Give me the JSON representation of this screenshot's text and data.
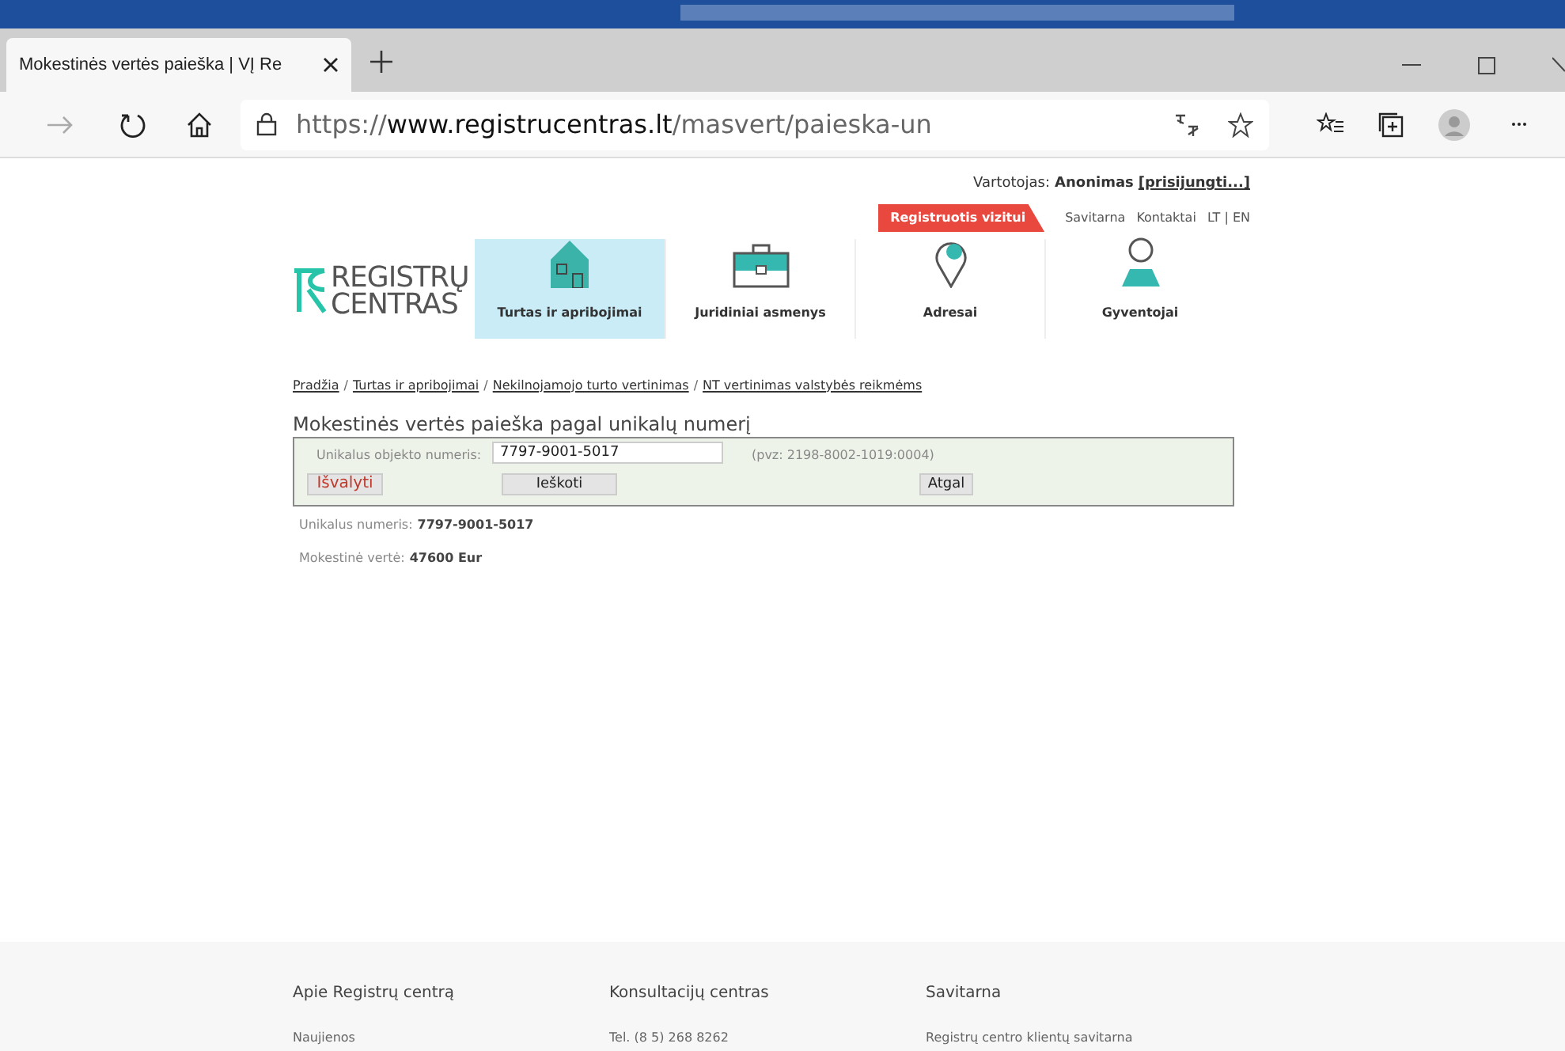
{
  "browser": {
    "tab_title": "Mokestinės vertės paieška | VĮ Re",
    "url_scheme": "https://",
    "url_host": "www.registrucentras.lt",
    "url_path": "/masvert/paieska-un"
  },
  "header": {
    "user_label": "Vartotojas:",
    "user_name": "Anonimas",
    "login_link": "[prisijungti...]",
    "links": [
      {
        "label": "Registruotis vizitui",
        "kind": "highlight"
      },
      {
        "label": "Savitarna",
        "kind": "plain"
      },
      {
        "label": "Kontaktai",
        "kind": "plain"
      },
      {
        "label": "LT | EN",
        "kind": "plain"
      }
    ]
  },
  "logo": {
    "lines": [
      "REGISTRŲ",
      "CENTRAS"
    ]
  },
  "nav": [
    {
      "label": "Turtas ir apribojimai",
      "kind": "house",
      "selected": true
    },
    {
      "label": "Juridiniai asmenys",
      "kind": "briefcase",
      "selected": false
    },
    {
      "label": "Adresai",
      "kind": "pin",
      "selected": false
    },
    {
      "label": "Gyventojai",
      "kind": "person",
      "selected": false
    }
  ],
  "breadcrumb": [
    {
      "label": "Pradžia"
    },
    {
      "separator": "/",
      "label": "Turtas ir apribojimai"
    },
    {
      "separator": "/",
      "label": "Nekilnojamojo turto vertinimas"
    },
    {
      "separator": "/",
      "label": "NT vertinimas valstybės reikmėms"
    }
  ],
  "form": {
    "title": "Mokestinės vertės paieška pagal unikalų numerį",
    "field_label": "Unikalus objekto numeris:",
    "value": "7797-9001-5017",
    "hint": "(pvz: 2198-8002-1019:0004)",
    "buttons": [
      {
        "label": "Išvalyti",
        "kind": "clear"
      },
      {
        "label": "Ieškoti",
        "kind": "search"
      },
      {
        "label": "Atgal",
        "kind": "back"
      }
    ]
  },
  "results": [
    {
      "label": "Unikalus numeris:",
      "value": "7797-9001-5017"
    },
    {
      "label": "Mokestinė vertė:",
      "value": "47600 Eur"
    }
  ],
  "footer": [
    {
      "heading": "Apie Registrų centrą",
      "items": [
        "Naujienos"
      ]
    },
    {
      "heading": "Konsultacijų centras",
      "items": [
        "Tel. (8 5) 268 8262"
      ]
    },
    {
      "heading": "Savitarna",
      "items": [
        "Registrų centro klientų savitarna"
      ]
    }
  ]
}
